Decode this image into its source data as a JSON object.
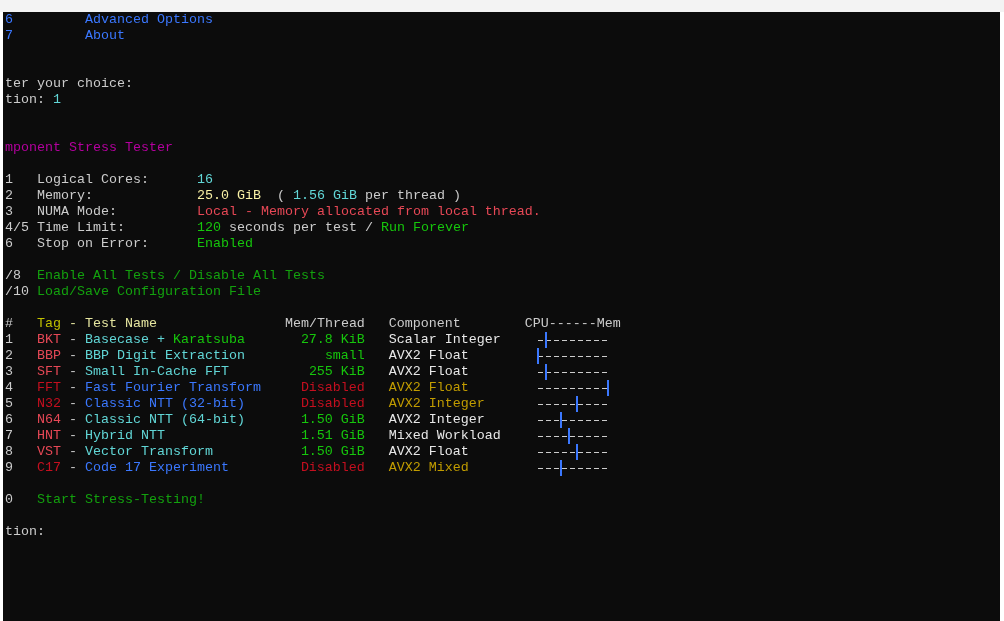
{
  "menu_items": [
    {
      "number": "6",
      "label": "Advanced Options"
    },
    {
      "number": "7",
      "label": "About"
    }
  ],
  "prompt": "ter your choice:",
  "option_prompt": {
    "label": "tion:",
    "value": "1"
  },
  "title": "mponent Stress Tester",
  "settings": [
    {
      "number": "1",
      "label": "Logical Cores:",
      "value": [
        {
          "text": "16",
          "kind": "info"
        }
      ]
    },
    {
      "number": "2",
      "label": "Memory:",
      "value": [
        {
          "text": "25.0 GiB",
          "kind": "highlight"
        },
        {
          "text": "  ( ",
          "kind": "plain"
        },
        {
          "text": "1.56 GiB",
          "kind": "info"
        },
        {
          "text": " per thread )",
          "kind": "plain"
        }
      ]
    },
    {
      "number": "3",
      "label": "NUMA Mode:",
      "value": [
        {
          "text": "Local - Memory allocated from local thread.",
          "kind": "warning"
        }
      ]
    },
    {
      "number": "4/5",
      "label": "Time Limit:",
      "value": [
        {
          "text": "120",
          "kind": "good"
        },
        {
          "text": " seconds per test / ",
          "kind": "plain"
        },
        {
          "text": "Run Forever",
          "kind": "good"
        }
      ]
    },
    {
      "number": "6",
      "label": "Stop on Error:",
      "value": [
        {
          "text": "Enabled",
          "kind": "good"
        }
      ]
    }
  ],
  "actions": [
    {
      "number": "/8",
      "label": "Enable All Tests / Disable All Tests"
    },
    {
      "number": "/10",
      "label": "Load/Save Configuration File"
    }
  ],
  "table": {
    "columns": [
      "#",
      "Tag",
      "-",
      "Test Name",
      "Mem/Thread",
      "Component",
      "CPU------Mem"
    ],
    "rows": [
      {
        "number": "1",
        "tag": "BKT",
        "separator": "-",
        "name": "Basecase +",
        "name_note": "Karatsuba",
        "mem": "27.8 KiB",
        "component": "Scalar Integer",
        "enabled": true,
        "level": 0.111
      },
      {
        "number": "2",
        "tag": "BBP",
        "separator": "-",
        "name": "BBP Digit Extraction",
        "mem": "small",
        "component": "AVX2 Float",
        "enabled": true,
        "level": 0
      },
      {
        "number": "3",
        "tag": "SFT",
        "separator": "-",
        "name": "Small In-Cache FFT",
        "mem": "255 KiB",
        "component": "AVX2 Float",
        "enabled": true,
        "level": 0.111
      },
      {
        "number": "4",
        "tag": "FFT",
        "separator": "-",
        "name": "Fast Fourier Transform",
        "mem": "Disabled",
        "component": "AVX2 Float",
        "enabled": false,
        "level": 1
      },
      {
        "number": "5",
        "tag": "N32",
        "separator": "-",
        "name": "Classic NTT (32-bit)",
        "mem": "Disabled",
        "component": "AVX2 Integer",
        "enabled": false,
        "level": 0.556
      },
      {
        "number": "6",
        "tag": "N64",
        "separator": "-",
        "name": "Classic NTT (64-bit)",
        "mem": "1.50 GiB",
        "component": "AVX2 Integer",
        "enabled": true,
        "level": 0.333
      },
      {
        "number": "7",
        "tag": "HNT",
        "separator": "-",
        "name": "Hybrid NTT",
        "mem": "1.51 GiB",
        "component": "Mixed Workload",
        "enabled": true,
        "level": 0.444
      },
      {
        "number": "8",
        "tag": "VST",
        "separator": "-",
        "name": "Vector Transform",
        "mem": "1.50 GiB",
        "component": "AVX2 Float",
        "enabled": true,
        "level": 0.556
      },
      {
        "number": "9",
        "tag": "C17",
        "separator": "-",
        "name": "Code 17 Experiment",
        "mem": "Disabled",
        "component": "AVX2 Mixed",
        "enabled": false,
        "level": 0.333
      }
    ]
  },
  "start": {
    "number": "0",
    "label": "Start Stress-Testing!"
  },
  "final_prompt": "tion:"
}
